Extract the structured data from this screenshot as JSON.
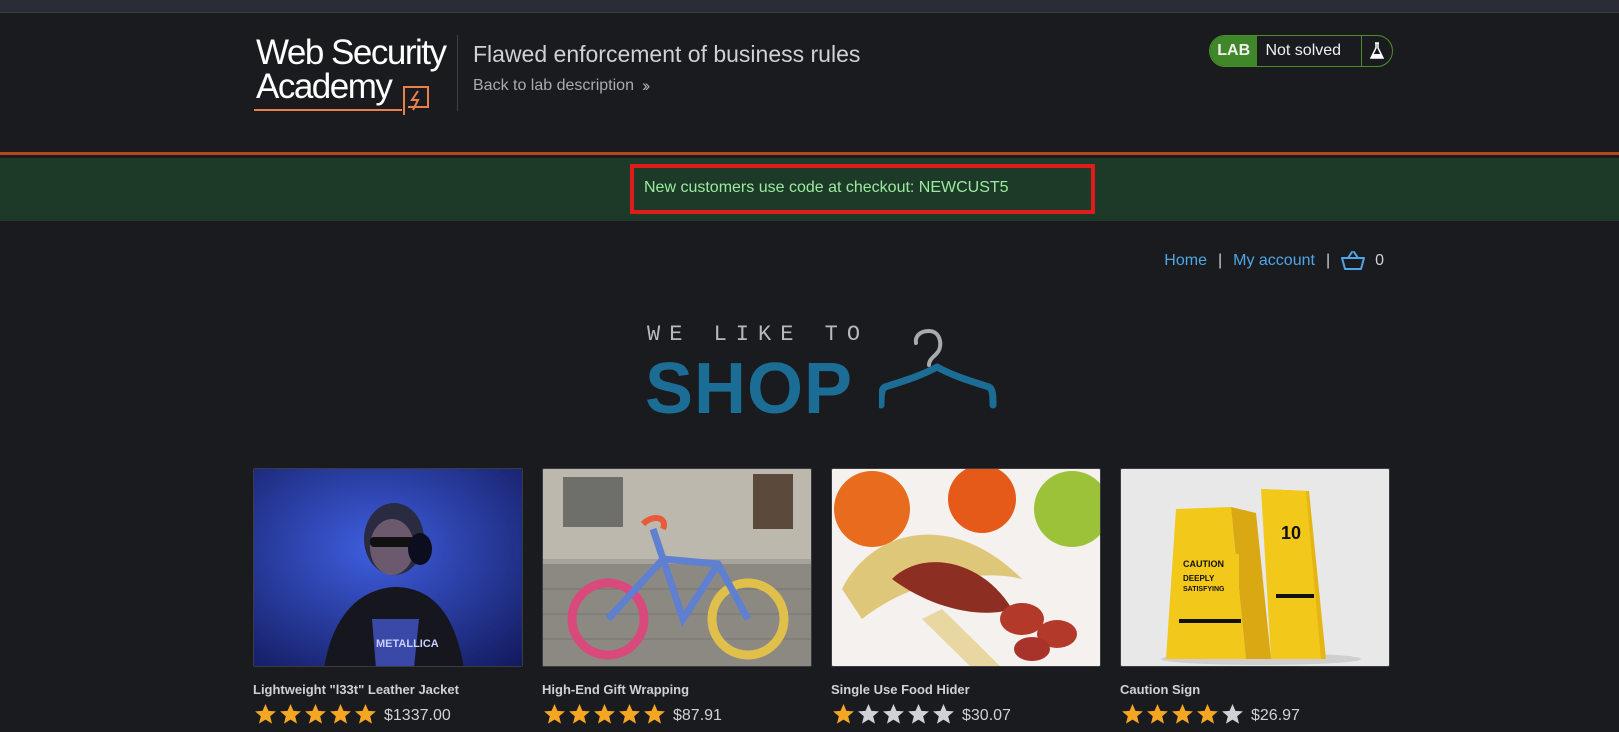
{
  "header": {
    "logo_line1": "Web Security",
    "logo_line2": "Academy",
    "lab_title": "Flawed enforcement of business rules",
    "back_link": "Back to lab description",
    "lab_label": "LAB",
    "lab_status": "Not solved"
  },
  "promo": {
    "text": "New customers use code at checkout: NEWCUST5"
  },
  "nav": {
    "home": "Home",
    "my_account": "My account",
    "cart_count": "0"
  },
  "shop_logo": {
    "tagline": "WE LIKE TO",
    "word": "SHOP"
  },
  "products": [
    {
      "name": "Lightweight \"l33t\" Leather Jacket",
      "price": "$1337.00",
      "rating": 5
    },
    {
      "name": "High-End Gift Wrapping",
      "price": "$87.91",
      "rating": 5
    },
    {
      "name": "Single Use Food Hider",
      "price": "$30.07",
      "rating": 1
    },
    {
      "name": "Caution Sign",
      "price": "$26.97",
      "rating": 4
    }
  ],
  "colors": {
    "accent_orange": "#b34818",
    "promo_bg": "#1c3a27",
    "promo_text": "#9ce9a0",
    "link_blue": "#4ea6e8",
    "shop_blue": "#1c6d95",
    "star_filled": "#f5a623",
    "star_empty": "#d0d2d5",
    "lab_green": "#3f8728",
    "highlight_red": "#e01b1b"
  }
}
